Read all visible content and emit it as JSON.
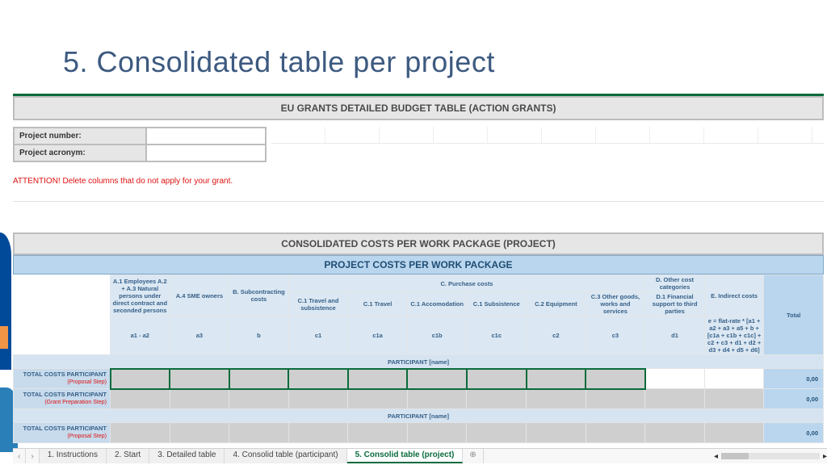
{
  "title": "5. Consolidated table per project",
  "top": {
    "banner": "EU GRANTS DETAILED BUDGET TABLE (ACTION GRANTS)",
    "project_number_label": "Project number:",
    "project_acronym_label": "Project acronym:",
    "warning": "ATTENTION! Delete columns that do not apply for your grant."
  },
  "mid": {
    "banner": "CONSOLIDATED COSTS PER WORK PACKAGE (PROJECT)",
    "sub_banner": "PROJECT COSTS PER WORK PACKAGE",
    "headers": {
      "a12": "A.1 Employees A.2 + A.3 Natural persons under direct contract and seconded persons",
      "a4": "A.4 SME owners",
      "b": "B. Subcontracting costs",
      "c": "C. Purchase costs",
      "c1ts": "C.1 Travel and subsistence",
      "c1t": "C.1 Travel",
      "c1a": "C.1 Accomodation",
      "c1s": "C.1 Subsistence",
      "c2": "C.2 Equipment",
      "c3": "C.3 Other goods, works and services",
      "d": "D. Other cost categories",
      "d1": "D.1 Financial support to third parties",
      "e": "E. Indirect costs",
      "e_formula": "e = flat-rate * [a1 + a2 + a3 + a5 + b + [c1a + c1b + c1c] + c2 + c3 + d1 + d2 + d3 + d4 + d5 + d6]",
      "total": "Total"
    },
    "codes": {
      "a12": "a1 - a2",
      "a4": "a3",
      "b": "b",
      "c1ts": "c1",
      "c1t": "c1a",
      "c1a": "c1b",
      "c1s": "c1c",
      "c2": "c2",
      "c3": "c3",
      "d1": "d1"
    },
    "rows": {
      "participant": "PARTICIPANT [name]",
      "tcp_label": "TOTAL COSTS PARTICIPANT",
      "step_proposal": "(Proposal Step)",
      "step_grant": "(Grant Preparation Step)",
      "total_value": "0,00"
    }
  },
  "tabs": {
    "nav_prev": "‹",
    "nav_next": "›",
    "items": [
      "1. Instructions",
      "2. Start",
      "3. Detailed table",
      "4. Consolid table (participant)",
      "5. Consolid table (project)"
    ],
    "add": "⊕"
  }
}
